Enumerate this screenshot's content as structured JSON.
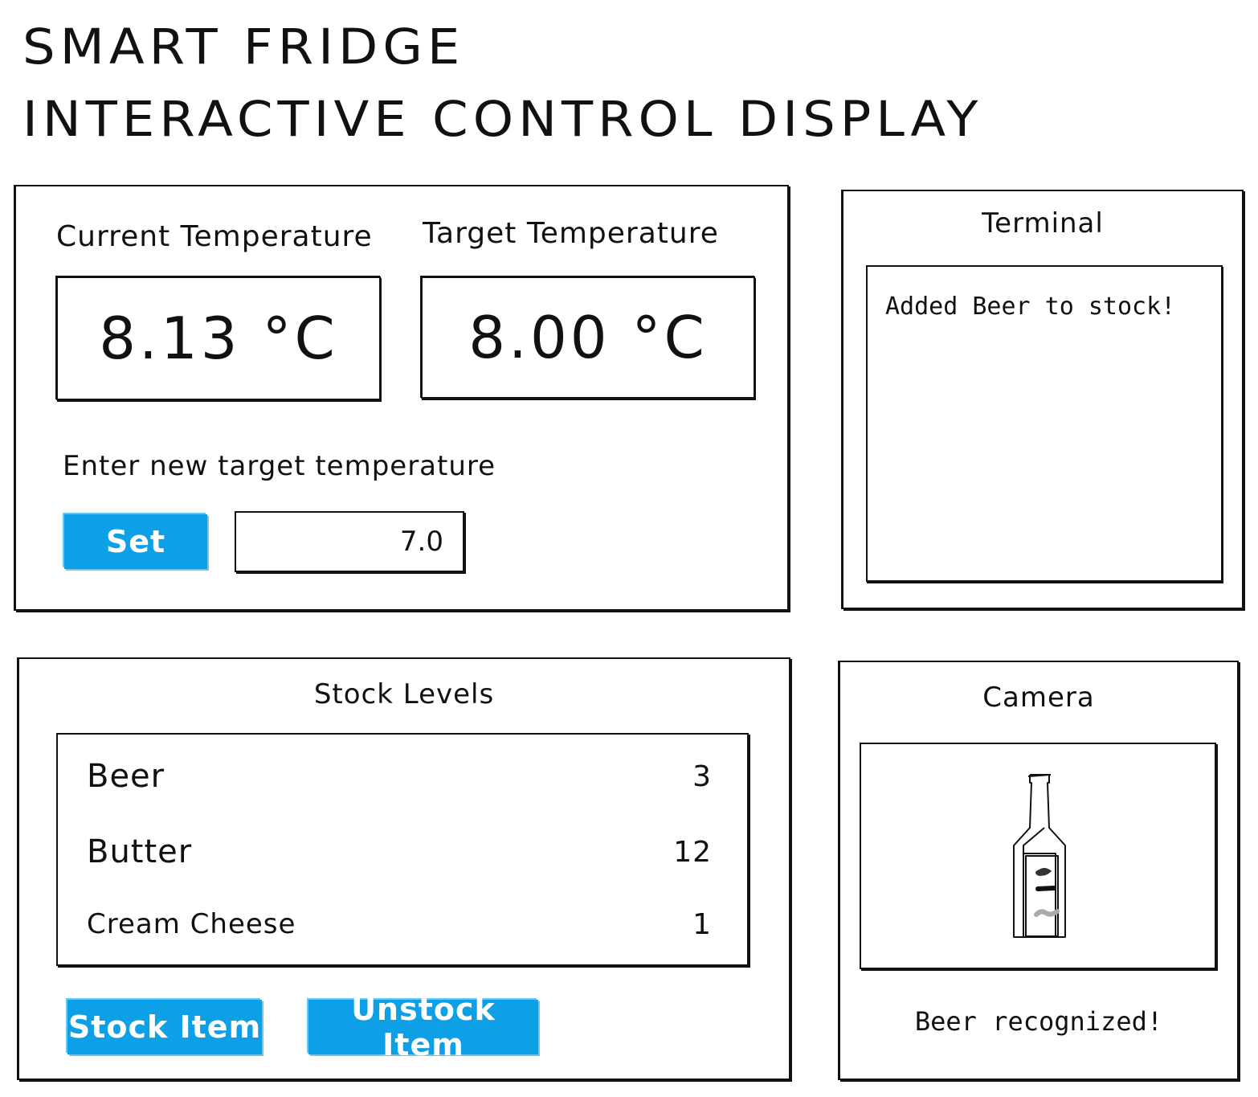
{
  "header": {
    "title_line1": "SMART FRIDGE",
    "title_line2": "INTERACTIVE CONTROL DISPLAY"
  },
  "temperature": {
    "current_label": "Current Temperature",
    "current_value": "8.13 °C",
    "target_label": "Target Temperature",
    "target_value": "8.00 °C",
    "enter_label": "Enter new target temperature",
    "set_button": "Set",
    "input_value": "7.0"
  },
  "terminal": {
    "title": "Terminal",
    "lines": [
      "Added Beer to stock!"
    ]
  },
  "stock": {
    "title": "Stock Levels",
    "items": [
      {
        "name": "Beer",
        "qty": "3"
      },
      {
        "name": "Butter",
        "qty": "12"
      },
      {
        "name": "Cream Cheese",
        "qty": "1"
      }
    ],
    "stock_button": "Stock Item",
    "unstock_button": "Unstock Item"
  },
  "camera": {
    "title": "Camera",
    "icon": "bottle-icon",
    "status": "Beer recognized!"
  },
  "colors": {
    "accent": "#0ea0e6"
  }
}
